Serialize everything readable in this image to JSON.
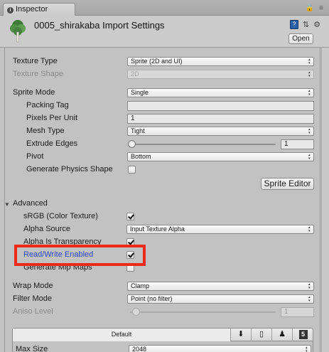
{
  "window": {
    "tab_title": "Inspector",
    "tab_icon": "info-icon"
  },
  "header": {
    "title": "0005_shirakaba Import Settings",
    "open_label": "Open",
    "help_glyph": "?",
    "icons": [
      "help-book-icon",
      "presets-icon",
      "gear-icon"
    ]
  },
  "fields": {
    "texture_type": {
      "label": "Texture Type",
      "value": "Sprite (2D and UI)"
    },
    "texture_shape": {
      "label": "Texture Shape",
      "value": "2D"
    },
    "sprite_mode": {
      "label": "Sprite Mode",
      "value": "Single"
    },
    "packing_tag": {
      "label": "Packing Tag",
      "value": ""
    },
    "pixels_per_unit": {
      "label": "Pixels Per Unit",
      "value": "1"
    },
    "mesh_type": {
      "label": "Mesh Type",
      "value": "Tight"
    },
    "extrude_edges": {
      "label": "Extrude Edges",
      "value": "1",
      "slider_fraction": 0.0
    },
    "pivot": {
      "label": "Pivot",
      "value": "Bottom"
    },
    "generate_physics_shape": {
      "label": "Generate Physics Shape",
      "checked": false
    },
    "sprite_editor_label": "Sprite Editor"
  },
  "advanced": {
    "label": "Advanced",
    "srgb": {
      "label": "sRGB (Color Texture)",
      "checked": true
    },
    "alpha_source": {
      "label": "Alpha Source",
      "value": "Input Texture Alpha"
    },
    "alpha_is_transparency": {
      "label": "Alpha Is Transparency",
      "checked": true
    },
    "read_write_enabled": {
      "label": "Read/Write Enabled",
      "checked": true
    },
    "generate_mip_maps": {
      "label": "Generate Mip Maps",
      "checked": false
    }
  },
  "wrap": {
    "wrap_mode": {
      "label": "Wrap Mode",
      "value": "Clamp"
    },
    "filter_mode": {
      "label": "Filter Mode",
      "value": "Point (no filter)"
    },
    "aniso_level": {
      "label": "Aniso Level",
      "value": "1",
      "slider_fraction": 0.0
    }
  },
  "platforms": {
    "default_tab": "Default",
    "tabs": [
      "download-icon",
      "mobile-icon",
      "android-icon",
      "html5-icon"
    ],
    "html5_glyph": "5"
  },
  "max_size": {
    "label": "Max Size",
    "value": "2048"
  },
  "highlight": {
    "color": "#ee2a16",
    "target": "read_write_enabled"
  },
  "colors": {
    "selected_label": "#2b45c6",
    "window_bg": "#c2c2c2"
  }
}
